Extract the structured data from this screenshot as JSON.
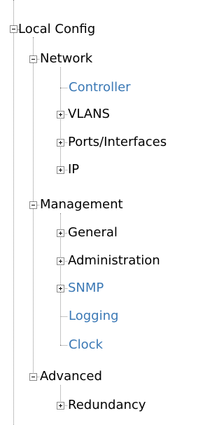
{
  "colors": {
    "text": "#000000",
    "link": "#3a78b5",
    "connector": "#8a8a8a"
  },
  "tree": {
    "local_config": {
      "label": "Local Config",
      "expanded": true,
      "icon": "collapse-box-icon",
      "children": {
        "network": {
          "label": "Network",
          "expanded": true,
          "icon": "collapse-box-icon",
          "items": [
            {
              "label": "Controller",
              "has_children": false,
              "style": "link"
            },
            {
              "label": "VLANS",
              "has_children": true,
              "expanded": false,
              "icon": "expand-box-icon",
              "style": "normal"
            },
            {
              "label": "Ports/Interfaces",
              "has_children": true,
              "expanded": false,
              "icon": "expand-box-icon",
              "style": "normal"
            },
            {
              "label": "IP",
              "has_children": true,
              "expanded": false,
              "icon": "expand-box-icon",
              "style": "normal"
            }
          ]
        },
        "management": {
          "label": "Management",
          "expanded": true,
          "icon": "collapse-box-icon",
          "items": [
            {
              "label": "General",
              "has_children": true,
              "expanded": false,
              "icon": "expand-box-icon",
              "style": "normal"
            },
            {
              "label": "Administration",
              "has_children": true,
              "expanded": false,
              "icon": "expand-box-icon",
              "style": "normal"
            },
            {
              "label": "SNMP",
              "has_children": true,
              "expanded": false,
              "icon": "expand-box-icon",
              "style": "link"
            },
            {
              "label": "Logging",
              "has_children": false,
              "style": "link"
            },
            {
              "label": "Clock",
              "has_children": false,
              "style": "link"
            }
          ]
        },
        "advanced": {
          "label": "Advanced",
          "expanded": true,
          "icon": "collapse-box-icon",
          "items": [
            {
              "label": "Redundancy",
              "has_children": true,
              "expanded": false,
              "icon": "expand-box-icon",
              "style": "normal"
            }
          ]
        }
      }
    }
  }
}
